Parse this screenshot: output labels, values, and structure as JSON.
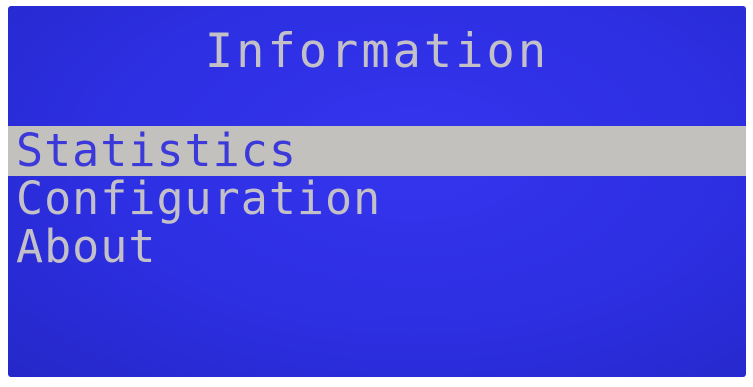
{
  "screen": {
    "title": "Information",
    "menu": {
      "items": [
        {
          "label": "Statistics",
          "selected": true
        },
        {
          "label": "Configuration",
          "selected": false
        },
        {
          "label": "About",
          "selected": false
        }
      ]
    }
  },
  "colors": {
    "screen_background": "#2f2fe6",
    "text": "#c3c0c8",
    "highlight_background": "#c3c1bd",
    "highlight_text": "#3b39d9"
  }
}
